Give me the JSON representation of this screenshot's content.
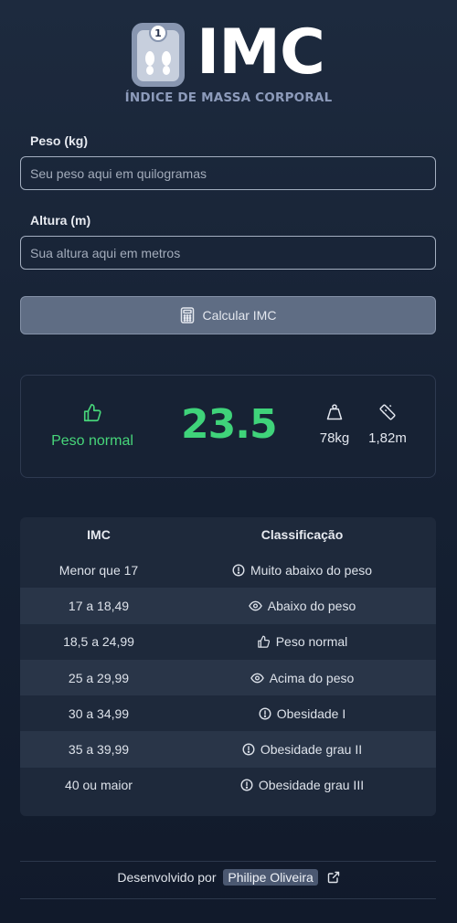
{
  "header": {
    "logo_text": "IMC",
    "subtitle": "ÍNDICE DE MASSA CORPORAL"
  },
  "form": {
    "weight_label": "Peso (kg)",
    "weight_placeholder": "Seu peso aqui em quilogramas",
    "height_label": "Altura (m)",
    "height_placeholder": "Sua altura aqui em metros",
    "calculate_label": "Calcular IMC"
  },
  "result": {
    "status": "Peso normal",
    "status_icon": "thumbs-up-icon",
    "value": "23.5",
    "weight": "78kg",
    "height": "1,82m",
    "accent_color": "#3fd37a"
  },
  "table": {
    "headers": [
      "IMC",
      "Classificação"
    ],
    "rows": [
      {
        "range": "Menor que 17",
        "classification": "Muito abaixo do peso",
        "icon": "alert-circle-icon"
      },
      {
        "range": "17 a 18,49",
        "classification": "Abaixo do peso",
        "icon": "eye-icon"
      },
      {
        "range": "18,5 a 24,99",
        "classification": "Peso normal",
        "icon": "thumbs-up-icon"
      },
      {
        "range": "25 a 29,99",
        "classification": "Acima do peso",
        "icon": "eye-icon"
      },
      {
        "range": "30 a 34,99",
        "classification": "Obesidade I",
        "icon": "alert-circle-icon"
      },
      {
        "range": "35 a 39,99",
        "classification": "Obesidade grau II",
        "icon": "alert-circle-icon"
      },
      {
        "range": "40 ou maior",
        "classification": "Obesidade grau III",
        "icon": "alert-circle-icon"
      }
    ]
  },
  "footer": {
    "prefix": "Desenvolvido por",
    "author": "Philipe Oliveira"
  }
}
